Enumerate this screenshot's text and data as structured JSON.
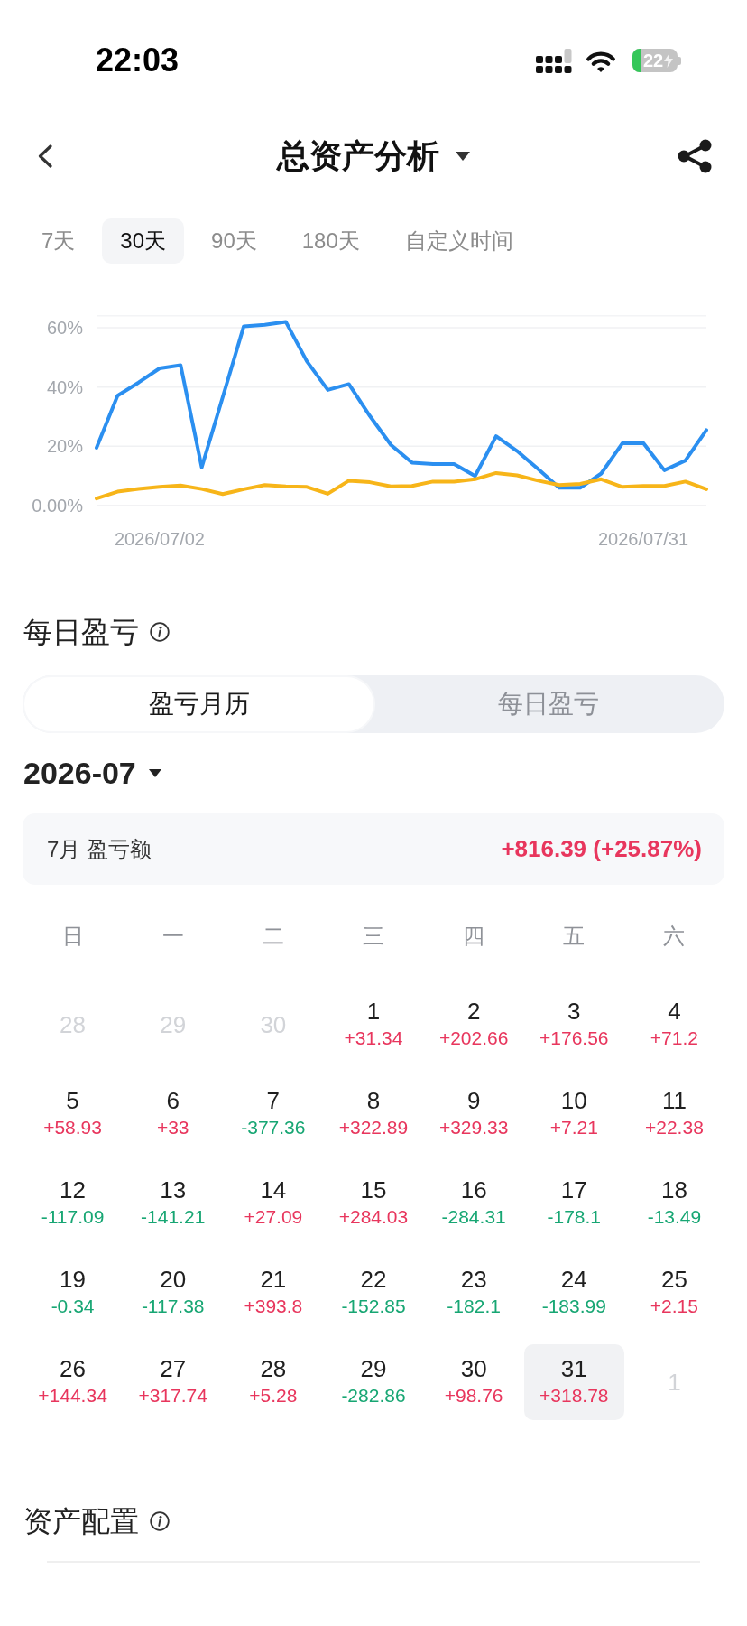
{
  "status_bar": {
    "time": "22:03",
    "battery": "22"
  },
  "header": {
    "title": "总资产分析"
  },
  "range_tabs": [
    {
      "label": "7天",
      "selected": false
    },
    {
      "label": "30天",
      "selected": true
    },
    {
      "label": "90天",
      "selected": false
    },
    {
      "label": "180天",
      "selected": false
    },
    {
      "label": "自定义时间",
      "selected": false
    }
  ],
  "chart": {
    "chart_data": {
      "type": "line",
      "categories": [
        null,
        null,
        null,
        "2026/07/02",
        null,
        null,
        null,
        null,
        null,
        null,
        null,
        null,
        null,
        null,
        null,
        null,
        null,
        null,
        null,
        null,
        null,
        null,
        null,
        null,
        null,
        null,
        "2026/07/31",
        null,
        null,
        null
      ],
      "grid": true,
      "ylim": [
        0,
        64
      ],
      "yticks": [
        {
          "value": 0,
          "label": "0.00%"
        },
        {
          "value": 20,
          "label": "20%"
        },
        {
          "value": 40,
          "label": "40%"
        },
        {
          "value": 60,
          "label": "60%"
        }
      ],
      "series": [
        {
          "color": "#2b8ff0",
          "values": [
            19.5,
            37.1,
            41.5,
            46.3,
            47.4,
            12.9,
            36.6,
            60.5,
            61.0,
            62.0,
            48.7,
            39.0,
            41.0,
            30.2,
            20.5,
            14.5,
            14.0,
            14.0,
            10.0,
            23.4,
            18.4,
            12.3,
            6.0,
            6.0,
            10.8,
            21.0,
            21.1,
            11.9,
            15.2,
            25.5
          ]
        },
        {
          "color": "#f7b519",
          "values": [
            2.4,
            4.7,
            5.6,
            6.3,
            6.8,
            5.6,
            3.9,
            5.5,
            6.9,
            6.5,
            6.3,
            4.0,
            8.4,
            7.9,
            6.5,
            6.6,
            8.1,
            8.1,
            8.9,
            11.0,
            10.2,
            8.4,
            6.9,
            7.3,
            8.9,
            6.3,
            6.6,
            6.6,
            8.1,
            5.5
          ]
        }
      ]
    }
  },
  "daily_section": {
    "title": "每日盈亏",
    "segments": [
      {
        "label": "盈亏月历",
        "selected": true
      },
      {
        "label": "每日盈亏",
        "selected": false
      }
    ],
    "month": "2026-07",
    "summary": {
      "label": "7月 盈亏额",
      "value": "+816.39 (+25.87%)"
    },
    "calendar": {
      "weekdays": [
        "日",
        "一",
        "二",
        "三",
        "四",
        "五",
        "六"
      ],
      "weeks": [
        {
          "days": [
            {
              "day": "28",
              "in_month": false,
              "selected": false
            },
            {
              "day": "29",
              "in_month": false,
              "selected": false
            },
            {
              "day": "30",
              "in_month": false,
              "selected": false
            },
            {
              "day": "1",
              "amount": "+31.34",
              "color": "#e8365d",
              "in_month": true,
              "selected": false
            },
            {
              "day": "2",
              "amount": "+202.66",
              "color": "#e8365d",
              "in_month": true,
              "selected": false
            },
            {
              "day": "3",
              "amount": "+176.56",
              "color": "#e8365d",
              "in_month": true,
              "selected": false
            },
            {
              "day": "4",
              "amount": "+71.2",
              "color": "#e8365d",
              "in_month": true,
              "selected": false
            }
          ]
        },
        {
          "days": [
            {
              "day": "5",
              "amount": "+58.93",
              "color": "#e8365d",
              "in_month": true,
              "selected": false
            },
            {
              "day": "6",
              "amount": "+33",
              "color": "#e8365d",
              "in_month": true,
              "selected": false
            },
            {
              "day": "7",
              "amount": "-377.36",
              "color": "#17a673",
              "in_month": true,
              "selected": false
            },
            {
              "day": "8",
              "amount": "+322.89",
              "color": "#e8365d",
              "in_month": true,
              "selected": false
            },
            {
              "day": "9",
              "amount": "+329.33",
              "color": "#e8365d",
              "in_month": true,
              "selected": false
            },
            {
              "day": "10",
              "amount": "+7.21",
              "color": "#e8365d",
              "in_month": true,
              "selected": false
            },
            {
              "day": "11",
              "amount": "+22.38",
              "color": "#e8365d",
              "in_month": true,
              "selected": false
            }
          ]
        },
        {
          "days": [
            {
              "day": "12",
              "amount": "-117.09",
              "color": "#17a673",
              "in_month": true,
              "selected": false
            },
            {
              "day": "13",
              "amount": "-141.21",
              "color": "#17a673",
              "in_month": true,
              "selected": false
            },
            {
              "day": "14",
              "amount": "+27.09",
              "color": "#e8365d",
              "in_month": true,
              "selected": false
            },
            {
              "day": "15",
              "amount": "+284.03",
              "color": "#e8365d",
              "in_month": true,
              "selected": false
            },
            {
              "day": "16",
              "amount": "-284.31",
              "color": "#17a673",
              "in_month": true,
              "selected": false
            },
            {
              "day": "17",
              "amount": "-178.1",
              "color": "#17a673",
              "in_month": true,
              "selected": false
            },
            {
              "day": "18",
              "amount": "-13.49",
              "color": "#17a673",
              "in_month": true,
              "selected": false
            }
          ]
        },
        {
          "days": [
            {
              "day": "19",
              "amount": "-0.34",
              "color": "#17a673",
              "in_month": true,
              "selected": false
            },
            {
              "day": "20",
              "amount": "-117.38",
              "color": "#17a673",
              "in_month": true,
              "selected": false
            },
            {
              "day": "21",
              "amount": "+393.8",
              "color": "#e8365d",
              "in_month": true,
              "selected": false
            },
            {
              "day": "22",
              "amount": "-152.85",
              "color": "#17a673",
              "in_month": true,
              "selected": false
            },
            {
              "day": "23",
              "amount": "-182.1",
              "color": "#17a673",
              "in_month": true,
              "selected": false
            },
            {
              "day": "24",
              "amount": "-183.99",
              "color": "#17a673",
              "in_month": true,
              "selected": false
            },
            {
              "day": "25",
              "amount": "+2.15",
              "color": "#e8365d",
              "in_month": true,
              "selected": false
            }
          ]
        },
        {
          "days": [
            {
              "day": "26",
              "amount": "+144.34",
              "color": "#e8365d",
              "in_month": true,
              "selected": false
            },
            {
              "day": "27",
              "amount": "+317.74",
              "color": "#e8365d",
              "in_month": true,
              "selected": false
            },
            {
              "day": "28",
              "amount": "+5.28",
              "color": "#e8365d",
              "in_month": true,
              "selected": false
            },
            {
              "day": "29",
              "amount": "-282.86",
              "color": "#17a673",
              "in_month": true,
              "selected": false
            },
            {
              "day": "30",
              "amount": "+98.76",
              "color": "#e8365d",
              "in_month": true,
              "selected": false
            },
            {
              "day": "31",
              "amount": "+318.78",
              "color": "#e8365d",
              "in_month": true,
              "selected": true
            },
            {
              "day": "1",
              "in_month": false,
              "selected": false
            }
          ]
        }
      ]
    }
  },
  "allocation_section": {
    "title": "资产配置"
  }
}
